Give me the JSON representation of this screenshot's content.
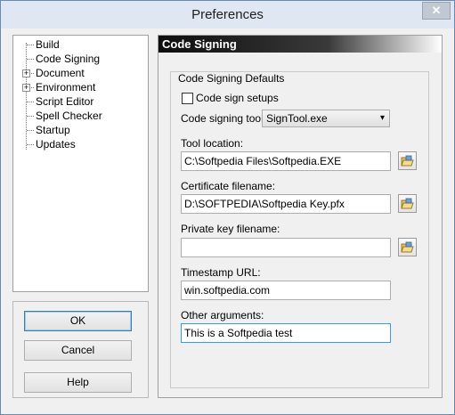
{
  "window": {
    "title": "Preferences",
    "close_glyph": "✕"
  },
  "tree": {
    "items": [
      {
        "label": "Build",
        "expandable": false
      },
      {
        "label": "Code Signing",
        "expandable": false
      },
      {
        "label": "Document",
        "expandable": true
      },
      {
        "label": "Environment",
        "expandable": true
      },
      {
        "label": "Script Editor",
        "expandable": false
      },
      {
        "label": "Spell Checker",
        "expandable": false
      },
      {
        "label": "Startup",
        "expandable": false
      },
      {
        "label": "Updates",
        "expandable": false
      }
    ],
    "expander_glyph": "+"
  },
  "buttons": {
    "ok": "OK",
    "cancel": "Cancel",
    "help": "Help"
  },
  "panel": {
    "header": "Code Signing",
    "group_title": "Code Signing Defaults",
    "code_sign_setups": {
      "label": "Code sign setups",
      "checked": false
    },
    "tool": {
      "label": "Code signing tool:",
      "value": "SignTool.exe",
      "arrow": "▾"
    },
    "tool_location": {
      "label": "Tool location:",
      "value": "C:\\Softpedia Files\\Softpedia.EXE"
    },
    "certificate": {
      "label": "Certificate filename:",
      "value": "D:\\SOFTPEDIA\\Softpedia Key.pfx"
    },
    "private_key": {
      "label": "Private key filename:",
      "value": ""
    },
    "timestamp": {
      "label": "Timestamp URL:",
      "value": "win.softpedia.com"
    },
    "other_args": {
      "label": "Other arguments:",
      "value": "This is a Softpedia test"
    }
  }
}
